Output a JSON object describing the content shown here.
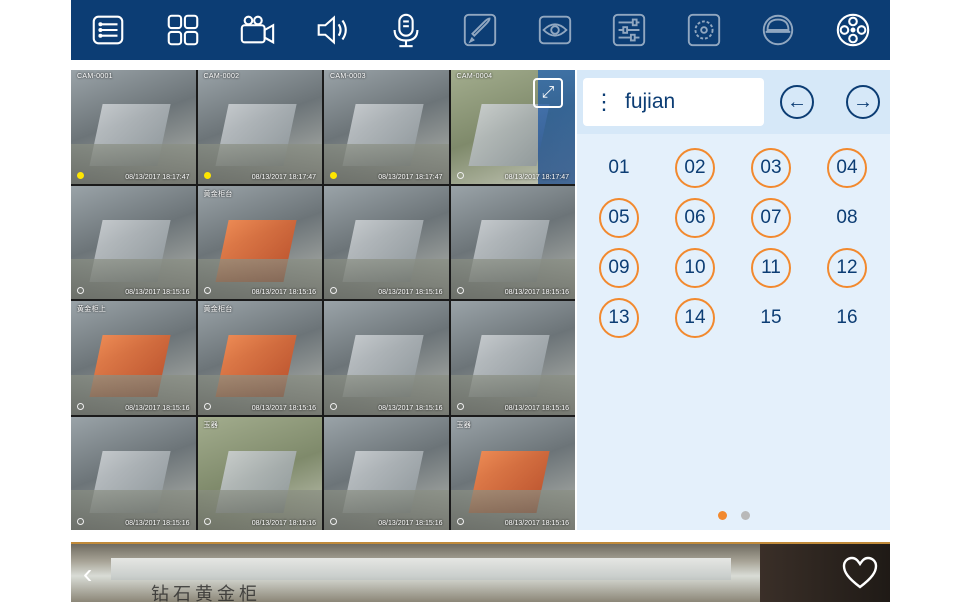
{
  "toolbar": {
    "icons": [
      "dvr-icon",
      "layout-grid-icon",
      "camera-icon",
      "speaker-icon",
      "microphone-icon",
      "rocket-icon",
      "eye-icon",
      "sliders-icon",
      "color-wheel-icon",
      "dome-camera-icon",
      "film-reel-icon"
    ]
  },
  "cameras": [
    {
      "label": "CAM-0001",
      "timestamp": "08/13/2017 18:17:47",
      "recording": true
    },
    {
      "label": "CAM-0002",
      "timestamp": "08/13/2017 18:17:47",
      "recording": true
    },
    {
      "label": "CAM-0003",
      "timestamp": "08/13/2017 18:17:47",
      "recording": true
    },
    {
      "label": "CAM-0004",
      "timestamp": "08/13/2017 18:17:47",
      "recording": false
    },
    {
      "label": "",
      "timestamp": "08/13/2017 18:15:16",
      "recording": false
    },
    {
      "label": "黄金柜台",
      "timestamp": "08/13/2017 18:15:16",
      "recording": false
    },
    {
      "label": "",
      "timestamp": "08/13/2017 18:15:16",
      "recording": false
    },
    {
      "label": "",
      "timestamp": "08/13/2017 18:15:16",
      "recording": false
    },
    {
      "label": "黄金柜上",
      "timestamp": "08/13/2017 18:15:16",
      "recording": false
    },
    {
      "label": "黄金柜台",
      "timestamp": "08/13/2017 18:15:16",
      "recording": false
    },
    {
      "label": "",
      "timestamp": "08/13/2017 18:15:16",
      "recording": false
    },
    {
      "label": "",
      "timestamp": "08/13/2017 18:15:16",
      "recording": false
    },
    {
      "label": "",
      "timestamp": "08/13/2017 18:15:16",
      "recording": false
    },
    {
      "label": "玉器",
      "timestamp": "08/13/2017 18:15:16",
      "recording": false
    },
    {
      "label": "",
      "timestamp": "08/13/2017 18:15:16",
      "recording": false
    },
    {
      "label": "玉器",
      "timestamp": "08/13/2017 18:15:16",
      "recording": false
    }
  ],
  "panel": {
    "device_name": "fujian",
    "prev_icon": "←",
    "next_icon": "→",
    "channels": [
      {
        "label": "01",
        "active": false
      },
      {
        "label": "02",
        "active": true
      },
      {
        "label": "03",
        "active": true
      },
      {
        "label": "04",
        "active": true
      },
      {
        "label": "05",
        "active": true
      },
      {
        "label": "06",
        "active": true
      },
      {
        "label": "07",
        "active": true
      },
      {
        "label": "08",
        "active": false
      },
      {
        "label": "09",
        "active": true
      },
      {
        "label": "10",
        "active": true
      },
      {
        "label": "11",
        "active": true
      },
      {
        "label": "12",
        "active": true
      },
      {
        "label": "13",
        "active": true
      },
      {
        "label": "14",
        "active": true
      },
      {
        "label": "15",
        "active": false
      },
      {
        "label": "16",
        "active": false
      }
    ],
    "page_count": 2,
    "current_page": 1
  },
  "strip": {
    "back_icon": "‹",
    "sign_text": "钻石黄金柜"
  },
  "colors": {
    "toolbar_bg": "#0c3d74",
    "accent": "#f2892e",
    "panel_bg": "#e4f0fb",
    "text": "#0c3d74"
  }
}
